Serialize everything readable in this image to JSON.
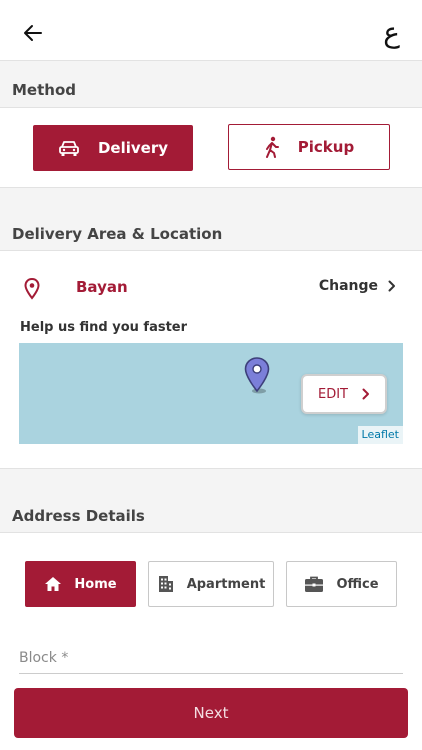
{
  "header": {
    "back_icon": "arrow-left-icon",
    "language_toggle": "ع"
  },
  "method": {
    "section_title": "Method",
    "options": [
      {
        "label": "Delivery",
        "icon": "car-icon",
        "selected": true
      },
      {
        "label": "Pickup",
        "icon": "walking-person-icon",
        "selected": false
      }
    ]
  },
  "delivery": {
    "section_title": "Delivery Area & Location",
    "area_name": "Bayan",
    "change_label": "Change",
    "help_text": "Help us find you faster",
    "map": {
      "edit_label": "EDIT",
      "attribution": "Leaflet"
    }
  },
  "address": {
    "section_title": "Address Details",
    "types": [
      {
        "label": "Home",
        "icon": "house-icon",
        "selected": true
      },
      {
        "label": "Apartment",
        "icon": "building-icon",
        "selected": false
      },
      {
        "label": "Office",
        "icon": "briefcase-icon",
        "selected": false
      }
    ],
    "block_placeholder": "Block *",
    "block_value": ""
  },
  "footer": {
    "next_label": "Next"
  },
  "colors": {
    "accent": "#a31b36",
    "section_bg": "#f4f4f4",
    "map_water": "#aad3df",
    "map_pin": "#7b7fd9"
  }
}
